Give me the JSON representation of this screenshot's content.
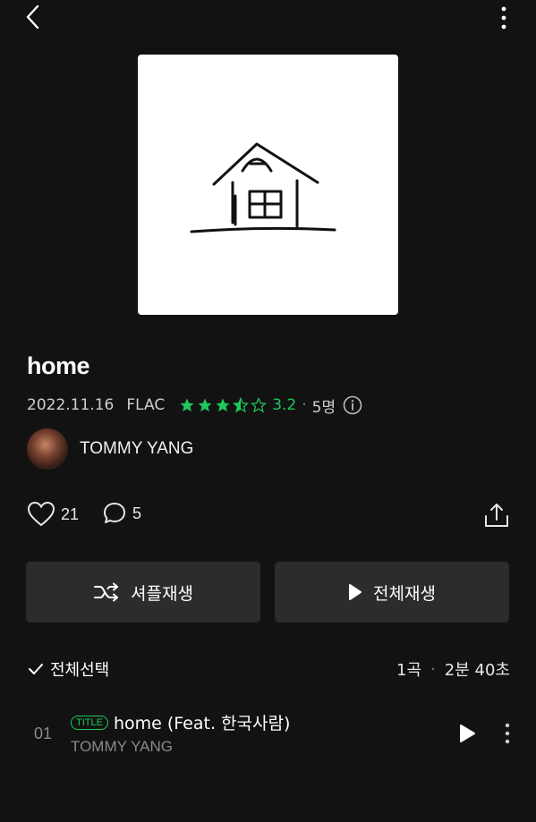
{
  "album": {
    "title": "home",
    "date": "2022.11.16",
    "format": "FLAC",
    "rating_stars": 3.5,
    "rating": "3.2",
    "rating_sep": "·",
    "rating_count": "5명"
  },
  "artist": {
    "name": "TOMMY YANG"
  },
  "social": {
    "likes": "21",
    "comments": "5"
  },
  "buttons": {
    "shuffle_label": "셔플재생",
    "playall_label": "전체재생"
  },
  "list_header": {
    "select_all_label": "전체선택",
    "song_count": "1곡",
    "sep": "·",
    "duration": "2분 40초"
  },
  "tracks": [
    {
      "number": "01",
      "badge": "TITLE",
      "title": "home (Feat. 한국사람)",
      "artist": "TOMMY YANG"
    }
  ],
  "colors": {
    "background": "#121212",
    "accent": "#1ec95c",
    "button_bg": "#2c2c2c"
  },
  "icons": [
    "back-arrow-icon",
    "more-vertical-icon",
    "star-icon",
    "info-icon",
    "heart-icon",
    "comment-icon",
    "share-icon",
    "shuffle-icon",
    "play-icon",
    "check-icon"
  ]
}
